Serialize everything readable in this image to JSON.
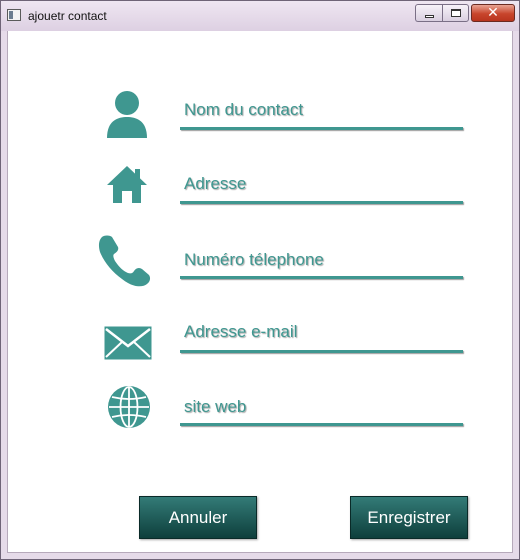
{
  "window": {
    "title": "ajouetr contact",
    "close_glyph": "✕"
  },
  "form": {
    "fields": [
      {
        "label": "Nom du contact",
        "icon": "person-icon"
      },
      {
        "label": "Adresse",
        "icon": "home-icon"
      },
      {
        "label": "Numéro télephone",
        "icon": "phone-icon"
      },
      {
        "label": "Adresse e-mail",
        "icon": "envelope-icon"
      },
      {
        "label": "site web",
        "icon": "globe-icon"
      }
    ]
  },
  "buttons": {
    "cancel_label": "Annuler",
    "save_label": "Enregistrer"
  },
  "colors": {
    "accent": "#3f9790",
    "button_top": "#337b77",
    "button_bottom": "#0e3f3c"
  }
}
